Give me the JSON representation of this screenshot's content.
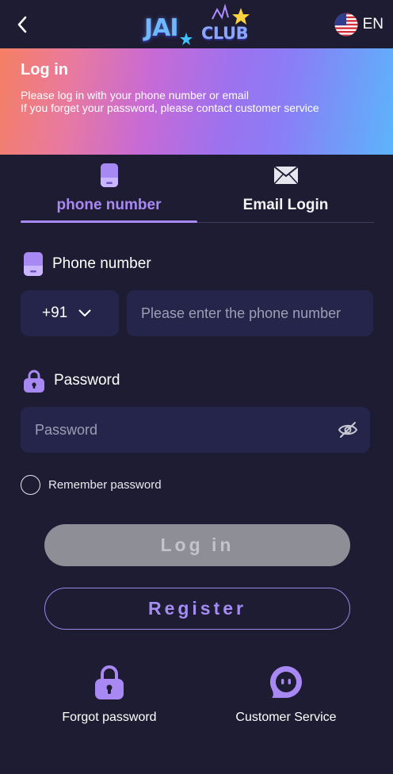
{
  "header": {
    "back_icon": "chevron-left-icon",
    "logo_text_main": "JAI",
    "logo_text_club": "CLUB",
    "language": {
      "flag": "us-flag-icon",
      "label": "EN"
    }
  },
  "banner": {
    "title": "Log in",
    "line1": "Please log in with your phone number or email",
    "line2": "If you forget your password, please contact customer service"
  },
  "tabs": [
    {
      "label": "phone number",
      "icon": "phone-icon",
      "active": true
    },
    {
      "label": "Email Login",
      "icon": "envelope-icon",
      "active": false
    }
  ],
  "phone": {
    "label": "Phone number",
    "country_code": "+91",
    "placeholder": "Please enter the phone number"
  },
  "password": {
    "label": "Password",
    "placeholder": "Password"
  },
  "remember": {
    "label": "Remember password"
  },
  "buttons": {
    "login": "Log in",
    "register": "Register"
  },
  "bottom_links": [
    {
      "label": "Forgot password",
      "icon": "lock-icon"
    },
    {
      "label": "Customer Service",
      "icon": "chat-icon"
    }
  ],
  "colors": {
    "background": "#1e1c33",
    "accent": "#a889f4",
    "input_bg": "#25244a",
    "login_button_bg": "#8e8e96"
  }
}
